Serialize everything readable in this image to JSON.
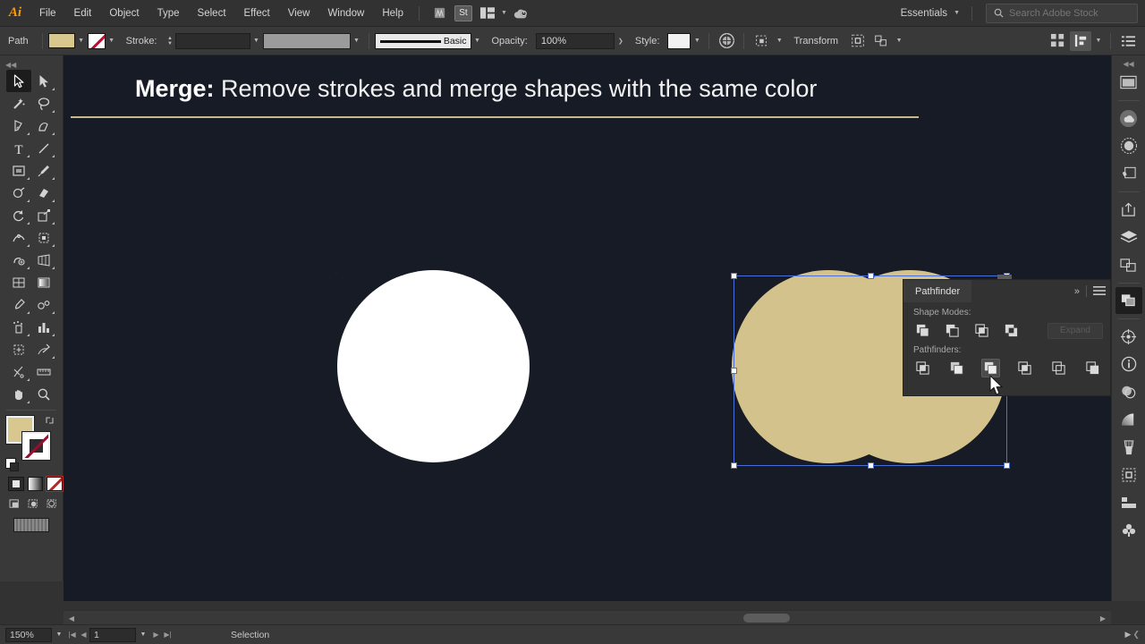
{
  "app": {
    "name": "Adobe Illustrator",
    "logo_text": "Ai"
  },
  "menubar": {
    "items": [
      {
        "label": "File"
      },
      {
        "label": "Edit"
      },
      {
        "label": "Object"
      },
      {
        "label": "Type"
      },
      {
        "label": "Select"
      },
      {
        "label": "Effect"
      },
      {
        "label": "View"
      },
      {
        "label": "Window"
      },
      {
        "label": "Help"
      }
    ],
    "bridge_icon": "bridge-icon",
    "stock_icon_label": "St",
    "arrange_icon": "arrange-documents-icon",
    "cc_icon": "cc-libraries-sync-icon",
    "workspace": "Essentials",
    "search_placeholder": "Search Adobe Stock",
    "search_value": "",
    "search_icon": "search-icon"
  },
  "controlbar": {
    "object_label": "Path",
    "fill_color": "#d9c790",
    "stroke_color": "none",
    "stroke_label": "Stroke:",
    "stroke_weight": "",
    "stroke_profile": "",
    "brush_label": "Basic",
    "opacity_label": "Opacity:",
    "opacity_value": "100%",
    "style_label": "Style:",
    "transform_label": "Transform",
    "recolor_icon": "recolor-artwork-icon",
    "select_similar_icon": "select-similar-objects-icon",
    "isolate_icon": "isolate-selected-object-icon",
    "align_icon": "align-icon",
    "distribute_icon": "distribute-spacing-icon",
    "options_icon": "panel-options-icon"
  },
  "toolbar": {
    "grip_icon": "collapse-grip-icon",
    "tools": [
      {
        "name": "selection-tool",
        "active": true
      },
      {
        "name": "direct-selection-tool",
        "active": false
      },
      {
        "name": "magic-wand-tool",
        "active": false
      },
      {
        "name": "lasso-tool",
        "active": false
      },
      {
        "name": "pen-tool",
        "active": false
      },
      {
        "name": "curvature-tool",
        "active": false
      },
      {
        "name": "type-tool",
        "active": false
      },
      {
        "name": "line-segment-tool",
        "active": false
      },
      {
        "name": "rectangle-tool",
        "active": false
      },
      {
        "name": "paintbrush-tool",
        "active": false
      },
      {
        "name": "shaper-tool",
        "active": false
      },
      {
        "name": "eraser-tool",
        "active": false
      },
      {
        "name": "rotate-tool",
        "active": false
      },
      {
        "name": "scale-tool",
        "active": false
      },
      {
        "name": "width-tool",
        "active": false
      },
      {
        "name": "free-transform-tool",
        "active": false
      },
      {
        "name": "shape-builder-tool",
        "active": false
      },
      {
        "name": "perspective-grid-tool",
        "active": false
      },
      {
        "name": "mesh-tool",
        "active": false
      },
      {
        "name": "gradient-tool",
        "active": false
      },
      {
        "name": "eyedropper-tool",
        "active": false
      },
      {
        "name": "blend-tool",
        "active": false
      },
      {
        "name": "symbol-sprayer-tool",
        "active": false
      },
      {
        "name": "column-graph-tool",
        "active": false
      },
      {
        "name": "artboard-tool",
        "active": false
      },
      {
        "name": "slice-tool",
        "active": false
      },
      {
        "name": "scissors-tool",
        "active": false
      },
      {
        "name": "measure-tool",
        "active": false
      },
      {
        "name": "hand-tool",
        "active": false
      },
      {
        "name": "zoom-tool",
        "active": false
      }
    ],
    "fill_swatch_color": "#d9c790",
    "stroke_swatch_color": "none",
    "swap-fill-stroke": "swap-fill-and-stroke-icon",
    "default_fill_stroke": "default-fill-and-stroke-icon",
    "color_modes": [
      "color-mode-button",
      "gradient-mode-button",
      "none-mode-button"
    ],
    "screen_modes": [
      "drawing-mode-normal",
      "drawing-mode-behind",
      "drawing-mode-inside"
    ],
    "screen_mode_toggle": "change-screen-mode-icon"
  },
  "canvas": {
    "background_color": "#161b26",
    "title_bold": "Merge:",
    "title_rest": " Remove strokes and merge shapes with the same color",
    "rule_color": "#c9b98a",
    "shapes": [
      {
        "name": "crescent-shape",
        "fill": "#d4c28d"
      },
      {
        "name": "white-circle-shape",
        "fill": "#ffffff"
      },
      {
        "name": "merged-union-shape",
        "fill": "#d4c28d",
        "selected": true
      }
    ],
    "selection_color": "#4a6fd6"
  },
  "pathfinder": {
    "title": "Pathfinder",
    "collapse_icon": "collapse-panel-icon",
    "menu_icon": "panel-menu-icon",
    "shape_modes_label": "Shape Modes:",
    "shape_modes": [
      {
        "name": "unite-button",
        "label": "Unite"
      },
      {
        "name": "minus-front-button",
        "label": "Minus Front"
      },
      {
        "name": "intersect-button",
        "label": "Intersect"
      },
      {
        "name": "exclude-button",
        "label": "Exclude"
      }
    ],
    "expand_label": "Expand",
    "expand_enabled": false,
    "pathfinders_label": "Pathfinders:",
    "pathfinders": [
      {
        "name": "divide-button",
        "label": "Divide",
        "selected": false
      },
      {
        "name": "trim-button",
        "label": "Trim",
        "selected": false
      },
      {
        "name": "merge-button",
        "label": "Merge",
        "selected": true
      },
      {
        "name": "crop-button",
        "label": "Crop",
        "selected": false
      },
      {
        "name": "outline-button",
        "label": "Outline",
        "selected": false
      },
      {
        "name": "minus-back-button",
        "label": "Minus Back",
        "selected": false
      }
    ]
  },
  "dock": {
    "grip_icon": "expand-dock-icon",
    "icons": [
      {
        "name": "artboards-panel-icon"
      },
      {
        "name": "cc-libraries-panel-icon"
      },
      {
        "name": "color-panel-icon"
      },
      {
        "name": "color-guide-panel-icon"
      },
      {
        "name": "export-panel-icon"
      },
      {
        "name": "layers-panel-icon"
      },
      {
        "name": "align-panel-icon"
      },
      {
        "name": "pathfinder-panel-icon",
        "active": true
      },
      {
        "name": "transform-panel-icon"
      },
      {
        "name": "document-info-panel-icon"
      },
      {
        "name": "transparency-panel-icon"
      },
      {
        "name": "gradient-panel-icon"
      },
      {
        "name": "brushes-panel-icon"
      },
      {
        "name": "appearance-panel-icon"
      },
      {
        "name": "paragraph-panel-icon"
      },
      {
        "name": "symbols-panel-icon"
      }
    ]
  },
  "statusbar": {
    "zoom_level": "150%",
    "page_number": "1",
    "first_icon": "first-artboard-icon",
    "prev_icon": "previous-artboard-icon",
    "next_icon": "next-artboard-icon",
    "last_icon": "last-artboard-icon",
    "status_text": "Selection",
    "forward_icon": "play-icon",
    "back_icon": "back-icon"
  },
  "scrollbar": {
    "left_icon": "scroll-left-icon",
    "right_icon": "scroll-right-icon"
  }
}
